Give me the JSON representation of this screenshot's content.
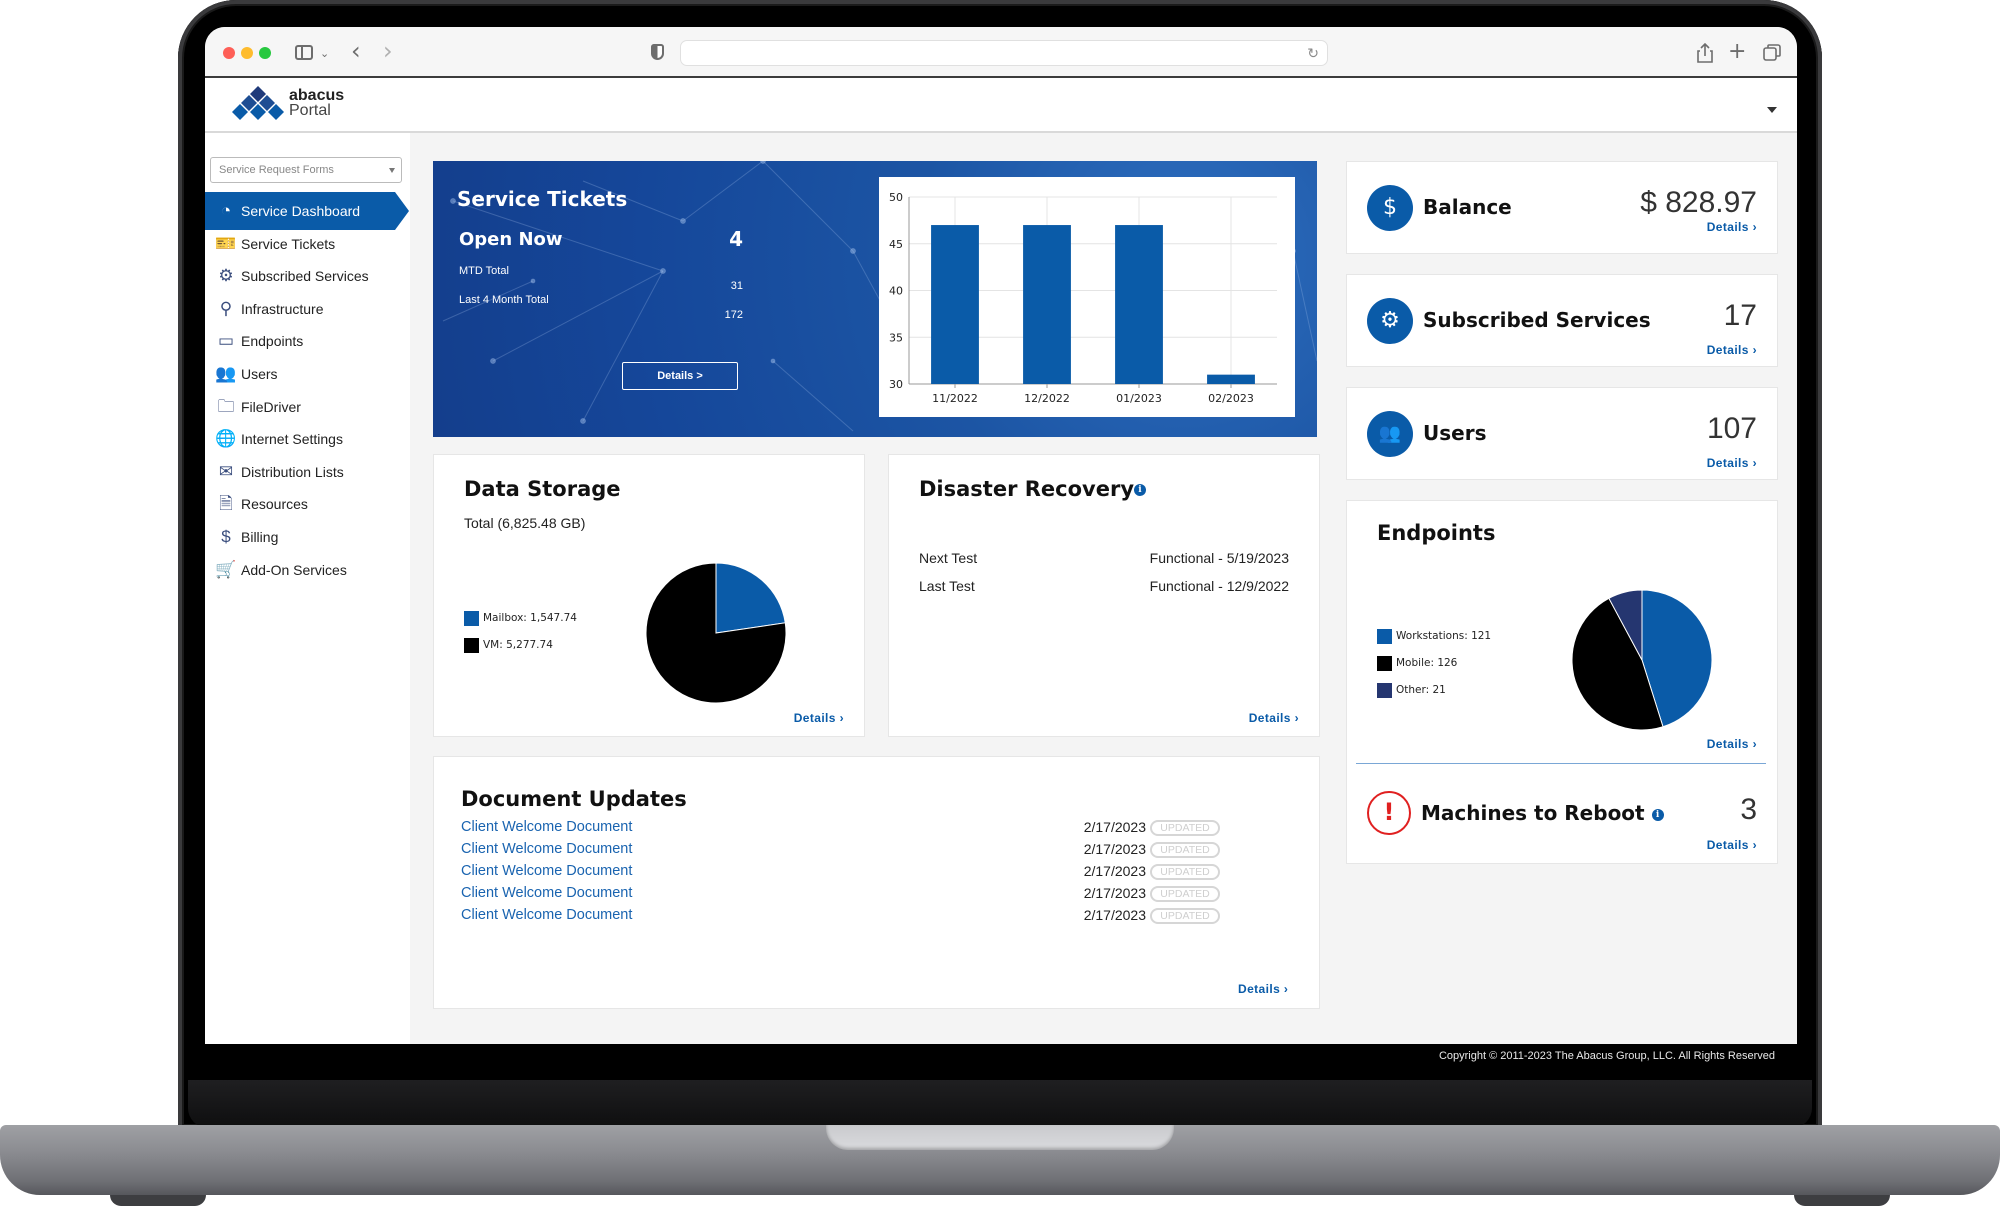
{
  "browser": {
    "address": "",
    "icons": [
      "sidebar-toggle-icon",
      "chevron-down-icon",
      "back-icon",
      "forward-icon",
      "shield-icon",
      "reload-icon",
      "share-icon",
      "new-tab-icon",
      "tabs-overview-icon"
    ]
  },
  "header": {
    "logo_line1": "abacus",
    "logo_line2": "Portal"
  },
  "sidebar": {
    "dropdown_placeholder": "Service Request Forms",
    "items": [
      {
        "label": "Service Dashboard",
        "icon": "dashboard-gauge-icon",
        "active": true
      },
      {
        "label": "Service Tickets",
        "icon": "ticket-icon"
      },
      {
        "label": "Subscribed Services",
        "icon": "gear-icon"
      },
      {
        "label": "Infrastructure",
        "icon": "network-tree-icon"
      },
      {
        "label": "Endpoints",
        "icon": "laptop-icon"
      },
      {
        "label": "Users",
        "icon": "users-icon"
      },
      {
        "label": "FileDriver",
        "icon": "folder-icon"
      },
      {
        "label": "Internet Settings",
        "icon": "globe-icon"
      },
      {
        "label": "Distribution Lists",
        "icon": "envelope-icon"
      },
      {
        "label": "Resources",
        "icon": "document-icon"
      },
      {
        "label": "Billing",
        "icon": "dollar-icon"
      },
      {
        "label": "Add-On Services",
        "icon": "cart-icon"
      }
    ]
  },
  "service_tickets": {
    "title": "Service Tickets",
    "open_now_label": "Open Now",
    "open_now_value": "4",
    "mtd_label": "MTD Total",
    "mtd_value": "31",
    "last4_label": "Last 4 Month Total",
    "last4_value": "172",
    "details_button": "Details >"
  },
  "data_storage": {
    "title": "Data Storage",
    "total": "Total (6,825.48 GB)",
    "legend": [
      {
        "label": "Mailbox:  1,547.74",
        "color": "#0a5ba8"
      },
      {
        "label": "VM:  5,277.74",
        "color": "#000000"
      }
    ],
    "details": "Details ›"
  },
  "disaster_recovery": {
    "title": "Disaster Recovery",
    "rows": [
      {
        "label": "Next Test",
        "value": "Functional - 5/19/2023"
      },
      {
        "label": "Last Test",
        "value": "Functional - 12/9/2022"
      }
    ],
    "details": "Details ›"
  },
  "document_updates": {
    "title": "Document Updates",
    "items": [
      {
        "name": "Client Welcome Document",
        "date": "2/17/2023",
        "badge": "UPDATED"
      },
      {
        "name": "Client Welcome Document",
        "date": "2/17/2023",
        "badge": "UPDATED"
      },
      {
        "name": "Client Welcome Document",
        "date": "2/17/2023",
        "badge": "UPDATED"
      },
      {
        "name": "Client Welcome Document",
        "date": "2/17/2023",
        "badge": "UPDATED"
      },
      {
        "name": "Client Welcome Document",
        "date": "2/17/2023",
        "badge": "UPDATED"
      }
    ],
    "details": "Details ›"
  },
  "stats": {
    "balance": {
      "label": "Balance",
      "value": "$ 828.97",
      "details": "Details ›"
    },
    "subscribed_services": {
      "label": "Subscribed Services",
      "value": "17",
      "details": "Details ›"
    },
    "users": {
      "label": "Users",
      "value": "107",
      "details": "Details ›"
    }
  },
  "endpoints": {
    "title": "Endpoints",
    "legend": [
      {
        "label": "Workstations:  121",
        "color": "#0a5ba8"
      },
      {
        "label": "Mobile:  126",
        "color": "#000000"
      },
      {
        "label": "Other:  21",
        "color": "#253670"
      }
    ],
    "details": "Details ›"
  },
  "reboot": {
    "label": "Machines to Reboot",
    "value": "3",
    "details": "Details ›"
  },
  "footer": {
    "copyright": "Copyright © 2011-2023 The Abacus Group, LLC.   All Rights Reserved"
  },
  "colors": {
    "brand_blue": "#0a5ba8",
    "alert_red": "#e02020"
  },
  "chart_data": [
    {
      "type": "bar",
      "title": "",
      "categories": [
        "11/2022",
        "12/2022",
        "01/2023",
        "02/2023"
      ],
      "values": [
        47,
        47,
        47,
        31
      ],
      "xlabel": "",
      "ylabel": "",
      "ylim": [
        30,
        50
      ],
      "yticks": [
        30,
        35,
        40,
        45,
        50
      ],
      "grid": true,
      "color": "#0a5ba8"
    },
    {
      "type": "pie",
      "title": "Data Storage",
      "labels": [
        "Mailbox",
        "VM"
      ],
      "values": [
        1547.74,
        5277.74
      ],
      "colors": [
        "#0a5ba8",
        "#000000"
      ],
      "legend": "left"
    },
    {
      "type": "pie",
      "title": "Endpoints",
      "labels": [
        "Workstations",
        "Mobile",
        "Other"
      ],
      "values": [
        121,
        126,
        21
      ],
      "colors": [
        "#0a5ba8",
        "#000000",
        "#253670"
      ],
      "legend": "left"
    }
  ]
}
